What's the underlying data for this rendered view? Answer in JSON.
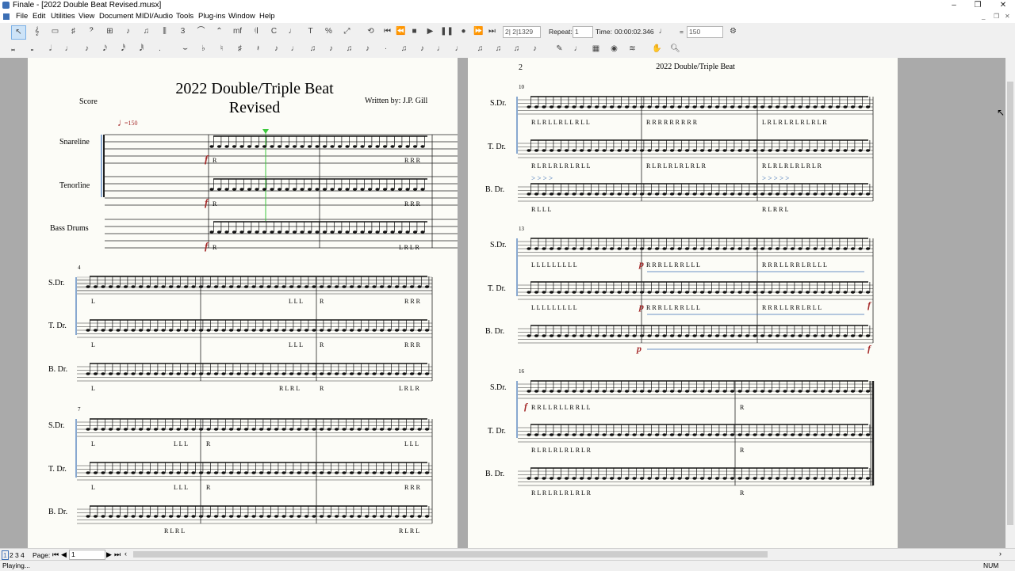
{
  "window": {
    "title": "Finale - [2022 Double Beat Revised.musx]",
    "minimize": "–",
    "maximize": "❐",
    "close": "✕"
  },
  "menu": [
    "File",
    "Edit",
    "Utilities",
    "View",
    "Document",
    "MIDI/Audio",
    "Tools",
    "Plug-ins",
    "Window",
    "Help"
  ],
  "playback": {
    "counter": "2| 2|1329",
    "repeat_label": "Repeat:",
    "repeat_value": "1",
    "time_label": "Time:",
    "time_value": "00:00:02.346",
    "equals": "=",
    "tempo": "150"
  },
  "pages": [
    {
      "title_line1": "2022 Double/Triple Beat",
      "title_line2": "Revised",
      "part_label": "Score",
      "composer": "Written by: J.P. Gill",
      "tempo_mark": "=150",
      "system1": {
        "instruments": [
          "Snareline",
          "Tenorline",
          "Bass Drums"
        ],
        "dynamic": "f",
        "sticking_rows": [
          {
            "left": "R",
            "right": "R R R"
          },
          {
            "left": "R",
            "right": "R R R"
          },
          {
            "left": "R",
            "right": "L R L R"
          }
        ]
      },
      "systems": [
        {
          "measure_number": "4",
          "instruments": [
            "S.Dr.",
            "T. Dr.",
            "B. Dr."
          ],
          "sticking_rows": [
            [
              "L",
              "L L L",
              "R",
              "R R R"
            ],
            [
              "L",
              "L L L",
              "R",
              "R R R"
            ],
            [
              "L",
              "R L R L",
              "R",
              "L R L R"
            ]
          ]
        },
        {
          "measure_number": "7",
          "instruments": [
            "S.Dr.",
            "T. Dr.",
            "B. Dr."
          ],
          "sticking_rows": [
            [
              "L",
              "L L L",
              "R",
              "L L L"
            ],
            [
              "L",
              "L L L",
              "R",
              "R R R"
            ],
            [
              "",
              "R L R L",
              "",
              "R L R L"
            ]
          ]
        }
      ]
    },
    {
      "page_number": "2",
      "running_title": "2022 Double/Triple Beat",
      "systems": [
        {
          "measure_number": "10",
          "instruments": [
            "S.Dr.",
            "T. Dr.",
            "B. Dr."
          ],
          "accent": ">",
          "sticking_rows": [
            [
              "R L R L L R L L R L L",
              "R R R   R R R   R R R",
              "L R L R L R L R L R L R"
            ],
            [
              "R L R L R L R L R L L",
              "R L R L R L R L R L R",
              "R L R L R L R L R L R"
            ],
            [
              "R L   L   L",
              "",
              "R L R   R L"
            ]
          ]
        },
        {
          "measure_number": "13",
          "instruments": [
            "S.Dr.",
            "T. Dr.",
            "B. Dr."
          ],
          "dynamic_start": "p",
          "dynamic_end": "f",
          "sticking_rows": [
            [
              "L L L   L L L   L L L",
              "R R R L L R R L L L",
              "R R R L L R R L R L L L"
            ],
            [
              "L L L   L L L   L L L",
              "R R R L L R R L L L",
              "R R R L L R R L R L L"
            ],
            [
              "",
              "",
              ""
            ]
          ]
        },
        {
          "measure_number": "16",
          "instruments": [
            "S.Dr.",
            "T. Dr.",
            "B. Dr."
          ],
          "dynamic": "f",
          "sticking_rows": [
            [
              "R  R  L  L  R  L  L  R  R  L  L",
              "R"
            ],
            [
              "R  L  R  L  R  L  R  L  R  L  R",
              "R"
            ],
            [
              "R  L  R  L  R  L  R  L  R  L  R",
              "R"
            ]
          ]
        }
      ]
    }
  ],
  "bottom": {
    "page_label": "Page:",
    "page_value": "1",
    "page_tabs": [
      "1",
      "2",
      "3",
      "4"
    ]
  },
  "status": {
    "left": "Playing...",
    "right": "NUM"
  }
}
